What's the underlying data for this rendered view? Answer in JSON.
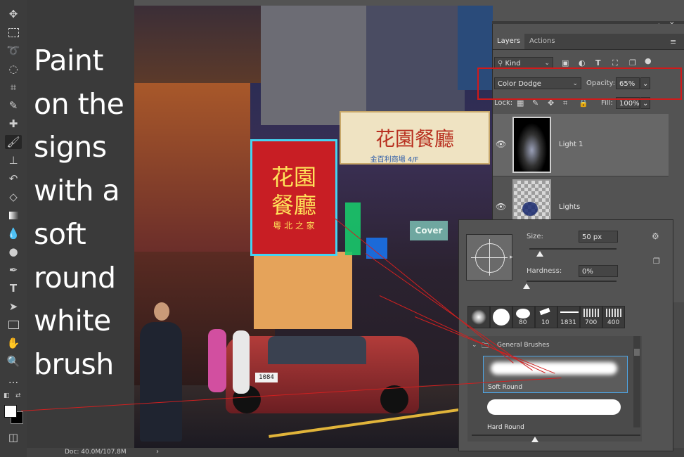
{
  "note": {
    "text": "Paint\non the\nsigns\nwith a\nsoft\nround\nwhite\nbrush"
  },
  "colors": {
    "foreground": "#ffffff",
    "background": "#000000",
    "accent": "#d11a1a"
  },
  "toolbar": {
    "tools": [
      "move-icon",
      "marquee-icon",
      "lasso-icon",
      "quick-select-icon",
      "crop-icon",
      "eyedropper-icon",
      "healing-icon",
      "brush-icon",
      "stamp-icon",
      "history-brush-icon",
      "eraser-icon",
      "gradient-icon",
      "blur-icon",
      "dodge-icon",
      "pen-icon",
      "type-icon",
      "path-select-icon",
      "rectangle-icon",
      "hand-icon",
      "zoom-icon",
      "more-icon"
    ],
    "type_glyph": "T",
    "more_glyph": "...",
    "active": "brush-icon"
  },
  "photo_signs": {
    "sign1": "花園餐廳",
    "sign1_sub": "金百利商場 4/F",
    "sign2": "花園",
    "sign2b": "餐廳",
    "sign2_sub": "粵 北 之 家",
    "sign3": "Cover",
    "plate": "1084"
  },
  "status": {
    "doc": "Doc: 40.0M/107.8M",
    "arrow": "›"
  },
  "layers_panel": {
    "tabs": [
      "Layers",
      "Actions"
    ],
    "active_tab": "Layers",
    "kind_filter": "Kind",
    "blend_mode": "Color Dodge",
    "opacity_label": "Opacity:",
    "opacity_value": "65%",
    "lock_label": "Lock:",
    "fill_label": "Fill:",
    "fill_value": "100%",
    "layers": [
      {
        "name": "Light 1",
        "selected": true
      },
      {
        "name": "Lights",
        "selected": false
      }
    ]
  },
  "brush_panel": {
    "size_label": "Size:",
    "size_value": "50 px",
    "size_fraction": 0.12,
    "hardness_label": "Hardness:",
    "hardness_value": "0%",
    "hardness_fraction": 0.0,
    "presets": [
      "",
      "",
      "80",
      "10",
      "1831",
      "700",
      "400"
    ],
    "group_name": "General Brushes",
    "brushes": [
      {
        "name": "Soft Round",
        "selected": true
      },
      {
        "name": "Hard Round",
        "selected": false
      }
    ]
  }
}
